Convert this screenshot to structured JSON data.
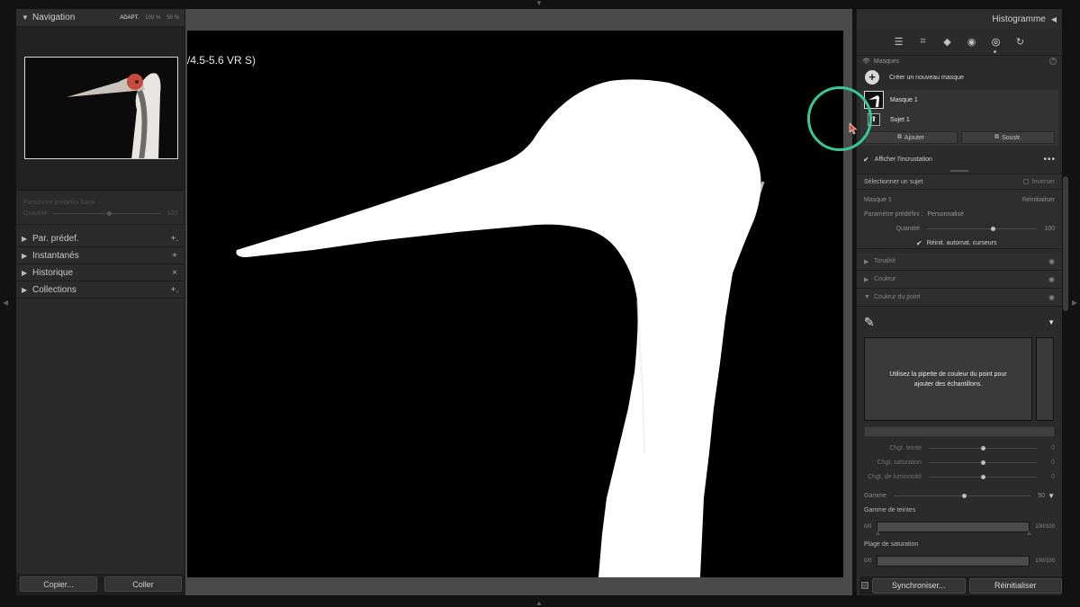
{
  "navigator": {
    "title": "Navigation",
    "zoom_options": [
      "ADAPT.",
      "100 %",
      "50 %"
    ]
  },
  "ghost_panel": {
    "line1": "Paramètre prédéfini   Base",
    "line2_label": "Quantité",
    "line2_value": "100"
  },
  "left_sections": [
    {
      "label": "Par. prédef.",
      "action": "+."
    },
    {
      "label": "Instantanés",
      "action": "+"
    },
    {
      "label": "Historique",
      "action": "×"
    },
    {
      "label": "Collections",
      "action": "+."
    }
  ],
  "left_footer": {
    "copy": "Copier...",
    "paste": "Coller"
  },
  "canvas": {
    "lens_text": "/4.5-5.6 VR S)"
  },
  "right_header": {
    "title": "Histogramme"
  },
  "tools": [
    {
      "icon": "sliders-icon",
      "glyph": "☰"
    },
    {
      "icon": "crop-icon",
      "glyph": "⌗"
    },
    {
      "icon": "healing-icon",
      "glyph": "◆"
    },
    {
      "icon": "red-eye-icon",
      "glyph": "◉"
    },
    {
      "icon": "masking-icon",
      "glyph": "◎"
    },
    {
      "icon": "reset-cycle-icon",
      "glyph": "↻"
    }
  ],
  "masks": {
    "title": "Masques",
    "create_label": "Créer un nouveau masque",
    "mask_name": "Masque 1",
    "sub_name": "Sujet 1",
    "add_label": "Ajouter",
    "subtract_label": "Soustr.",
    "overlay_label": "Afficher l'incrustation"
  },
  "subject": {
    "title": "Sélectionner un sujet",
    "invert": "Inverser"
  },
  "mask_props": {
    "mask_name": "Masque 1",
    "reset": "Réinitialiser",
    "preset_label": "Paramètre prédéfini :",
    "preset_value": "Personnalisé",
    "amount_label": "Quantité",
    "amount_value": "100",
    "auto_reset_label": "Réinit. automat. curseurs"
  },
  "sections": {
    "tone": "Tonalité",
    "color": "Couleur",
    "point_color": "Couleur du point"
  },
  "point_color": {
    "hint": "Utilisez la pipette de couleur du point pour ajouter des échantillons.",
    "sliders": [
      {
        "label": "Chgt. teinte",
        "value": "0"
      },
      {
        "label": "Chgt. saturation",
        "value": "0"
      },
      {
        "label": "Chgt. de luminosité",
        "value": "0"
      }
    ],
    "gamme_label": "Gamme",
    "gamme_value": "50",
    "hue_range_title": "Gamme de teintes",
    "hue_min": "0/0",
    "hue_max": "100/100",
    "sat_range_title": "Plage de saturation",
    "sat_min": "0/0",
    "sat_max": "100/100"
  },
  "right_footer": {
    "sync": "Synchroniser...",
    "reset": "Réinitialiser"
  },
  "colors": {
    "accent_circle": "#37c79a",
    "cursor": "#e04a3a"
  }
}
